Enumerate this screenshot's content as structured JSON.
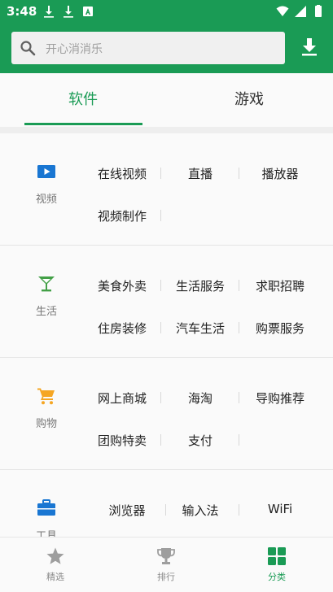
{
  "status_bar": {
    "time": "3:48"
  },
  "search": {
    "placeholder": "开心消消乐"
  },
  "tabs": [
    {
      "label": "软件",
      "active": true
    },
    {
      "label": "游戏",
      "active": false
    }
  ],
  "categories": [
    {
      "name": "视频",
      "icon": "play-icon",
      "color": "#1976d2",
      "items": [
        "在线视频",
        "直播",
        "播放器",
        "视频制作"
      ]
    },
    {
      "name": "生活",
      "icon": "cocktail-icon",
      "color": "#43a047",
      "items": [
        "美食外卖",
        "生活服务",
        "求职招聘",
        "住房装修",
        "汽车生活",
        "购票服务"
      ]
    },
    {
      "name": "购物",
      "icon": "cart-icon",
      "color": "#f5a623",
      "items": [
        "网上商城",
        "海淘",
        "导购推荐",
        "团购特卖",
        "支付"
      ]
    },
    {
      "name": "工具",
      "icon": "toolbox-icon",
      "color": "#1976d2",
      "items": [
        "浏览器",
        "输入法",
        "WiFi"
      ]
    }
  ],
  "bottom_nav": [
    {
      "label": "精选",
      "icon": "star-icon",
      "active": false
    },
    {
      "label": "排行",
      "icon": "trophy-icon",
      "active": false
    },
    {
      "label": "分类",
      "icon": "grid-icon",
      "active": true
    }
  ],
  "colors": {
    "primary": "#1a9b55",
    "inactive": "#9e9e9e"
  }
}
